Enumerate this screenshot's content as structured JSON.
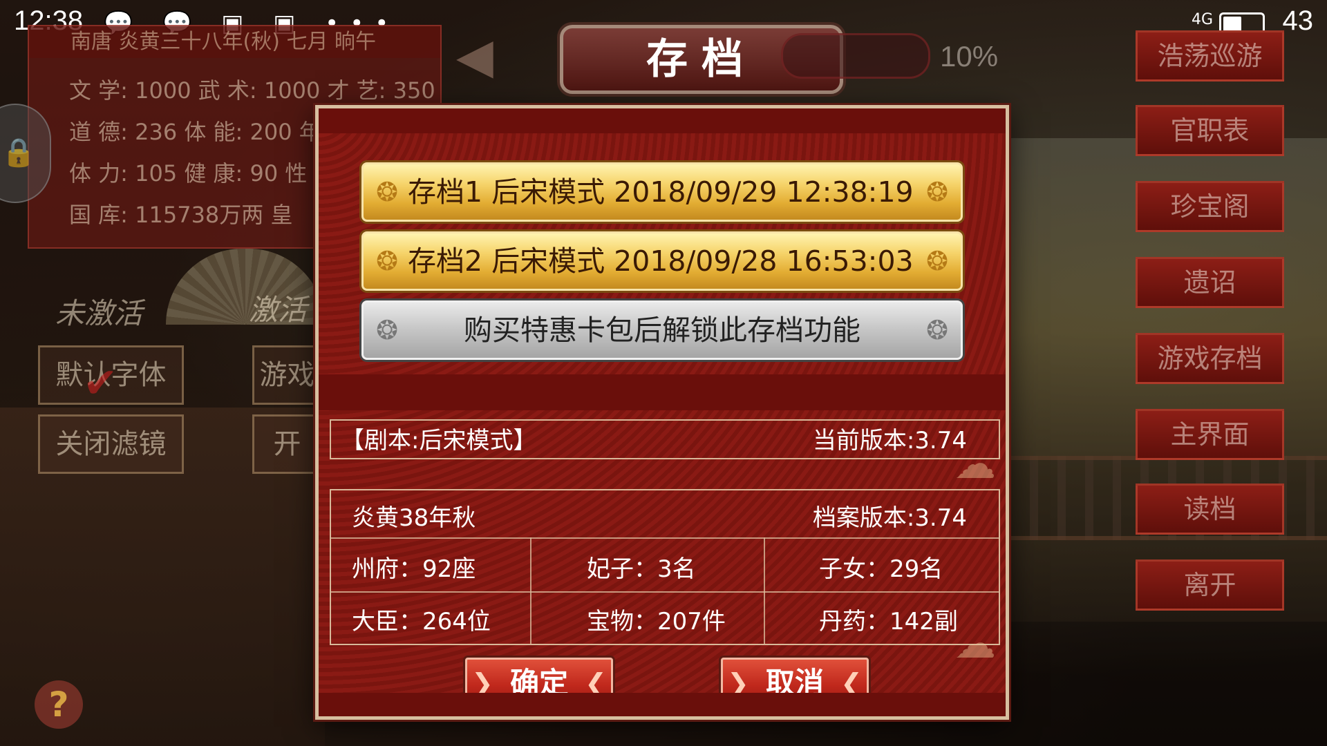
{
  "status_bar": {
    "time": "12:38",
    "left_icons": "💬 💬 ▣ ▣ •••",
    "signal": "4G",
    "battery": "43"
  },
  "info_panel": {
    "header": "南唐 炎黄三十八年(秋) 七月 晌午",
    "rows": [
      "文 学: 1000  武 术: 1000  才 艺: 350",
      "道 德: 236   体 能: 200   年",
      "体 力: 105   健 康: 90    性",
      "国 库: 115738万两          皇"
    ]
  },
  "settings": {
    "inactive_label": "未激活",
    "active_label": "激活",
    "default_font": "默认字体",
    "game": "游戏",
    "close_filter": "关闭滤镜",
    "open": "开"
  },
  "title_bar": {
    "title": "存档",
    "volume_percent": "10%"
  },
  "right_menu": [
    "浩荡巡游",
    "官职表",
    "珍宝阁",
    "遗诏",
    "游戏存档",
    "主界面",
    "读档",
    "离开"
  ],
  "dialog": {
    "slots": [
      {
        "text": "存档1  后宋模式  2018/09/29 12:38:19",
        "state": "gold"
      },
      {
        "text": "存档2  后宋模式  2018/09/28 16:53:03",
        "state": "gold"
      },
      {
        "text": "购买特惠卡包后解锁此存档功能",
        "state": "locked"
      }
    ],
    "script_label": "【剧本:后宋模式】",
    "current_version": "当前版本:3.74",
    "save_date": "炎黄38年秋",
    "save_version": "档案版本:3.74",
    "stats": {
      "prefectures": "州府：92座",
      "consorts": "妃子：3名",
      "children": "子女：29名",
      "ministers": "大臣：264位",
      "treasures": "宝物：207件",
      "elixirs": "丹药：142副"
    },
    "confirm": "确定",
    "cancel": "取消"
  },
  "help": "?"
}
